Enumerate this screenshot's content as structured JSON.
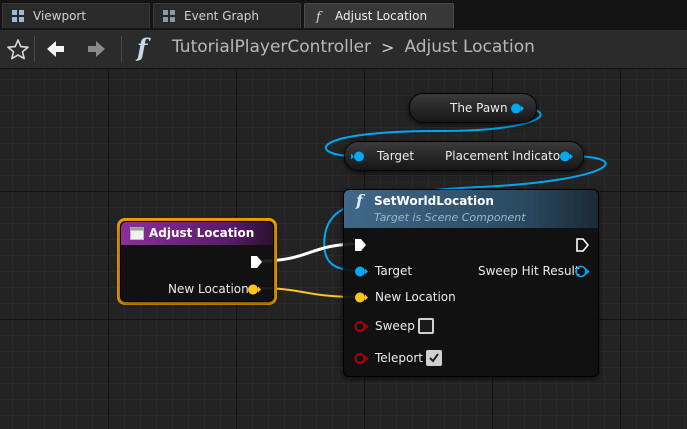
{
  "tabs": [
    {
      "label": "Viewport",
      "icon": "viewport-icon",
      "active": false
    },
    {
      "label": "Event Graph",
      "icon": "event-graph-icon",
      "active": false
    },
    {
      "label": "Adjust Location",
      "icon": "function-icon",
      "active": true,
      "close": "×"
    }
  ],
  "toolbar": {
    "function_glyph": "f",
    "breadcrumb": [
      "TutorialPlayerController",
      "Adjust Location"
    ],
    "separator": ">"
  },
  "nodes": {
    "the_pawn": {
      "label": "The Pawn"
    },
    "placement_indicator": {
      "target_label": "Target",
      "output_label": "Placement Indicator"
    },
    "set_world_location": {
      "title": "SetWorldLocation",
      "subtitle": "Target is Scene Component",
      "target_label": "Target",
      "sweep_hit_result_label": "Sweep Hit Result",
      "new_location_label": "New Location",
      "sweep_label": "Sweep",
      "sweep_checked": false,
      "teleport_label": "Teleport",
      "teleport_checked": true
    },
    "adjust_location": {
      "title": "Adjust Location",
      "new_location_label": "New Location"
    }
  },
  "colors": {
    "object_pin": "#00a8f4",
    "vector_pin": "#fdc51d",
    "bool_pin": "#8c0000",
    "exec": "#ffffff",
    "function_header": "#3f5f7a",
    "event_header": "#7a2b8c",
    "selection": "#f7a400"
  }
}
